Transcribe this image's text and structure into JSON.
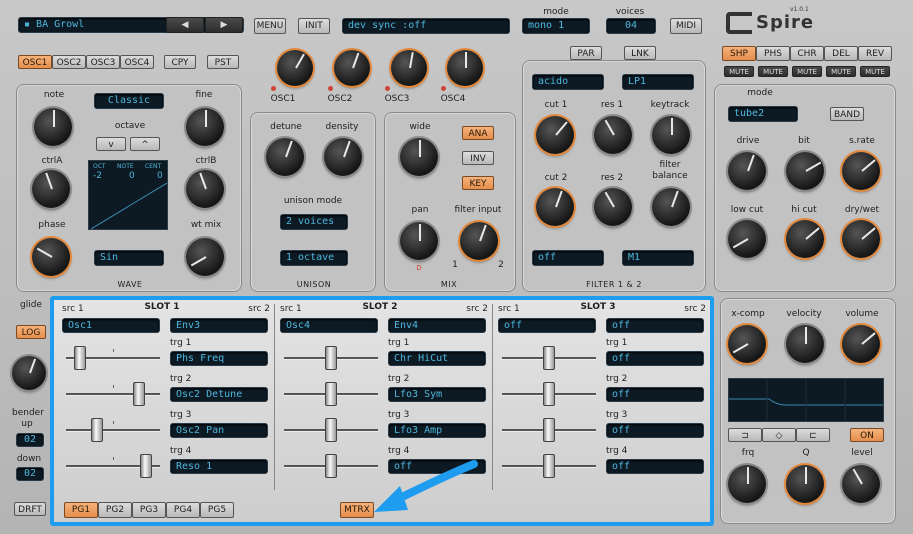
{
  "header": {
    "preset": "BA Growl",
    "menu": "MENU",
    "init": "INIT",
    "sync": "dev sync :off",
    "mode_label": "mode",
    "mode_value": "mono 1",
    "voices_label": "voices",
    "voices_value": "04",
    "midi": "MIDI",
    "logo": "Spire",
    "version": "v1.0.1"
  },
  "osc_tabs": [
    "OSC1",
    "OSC2",
    "OSC3",
    "OSC4"
  ],
  "copy": "CPY",
  "paste": "PST",
  "osc_knob_labels": [
    "OSC1",
    "OSC2",
    "OSC3",
    "OSC4"
  ],
  "par": "PAR",
  "lnk": "LNK",
  "fx_tabs": [
    "SHP",
    "PHS",
    "CHR",
    "DEL",
    "REV"
  ],
  "mute": "MUTE",
  "osc": {
    "note": "note",
    "fine": "fine",
    "mode": "Classic",
    "octave": "octave",
    "down": "v",
    "up": "^",
    "ctrlA": "ctrlA",
    "ctrlB": "ctrlB",
    "phase": "phase",
    "wtmix": "wt mix",
    "wave": "Sin",
    "section": "WAVE",
    "disp_oct": "OCT",
    "disp_note": "NOTE",
    "disp_cent": "CENT",
    "oct_val": "-2",
    "note_val": "0",
    "cent_val": "0"
  },
  "unison": {
    "detune": "detune",
    "density": "density",
    "mode_label": "unison mode",
    "voices": "2 voices",
    "octave": "1 octave",
    "section": "UNISON"
  },
  "mix": {
    "wide": "wide",
    "ana": "ANA",
    "inv": "INV",
    "key": "KEY",
    "pan": "pan",
    "filter_input": "filter input",
    "section": "MIX",
    "l": "D",
    "one": "1",
    "two": "2"
  },
  "filter": {
    "type1": "acido",
    "type2": "LP1",
    "cut1": "cut 1",
    "res1": "res 1",
    "keytrack": "keytrack",
    "cut2": "cut 2",
    "res2": "res 2",
    "balance": "filter balance",
    "mode1": "off",
    "mode2": "M1",
    "section": "FILTER 1 & 2"
  },
  "shape": {
    "mode_label": "mode",
    "mode": "tube2",
    "band": "BAND",
    "drive": "drive",
    "bit": "bit",
    "srate": "s.rate",
    "lowcut": "low cut",
    "hicut": "hi cut",
    "drywet": "dry/wet"
  },
  "side": {
    "glide": "glide",
    "log": "LOG",
    "bender_up": "bender up",
    "up_val": "02",
    "down": "down",
    "down_val": "02",
    "drft": "DRFT"
  },
  "eq": {
    "xcomp": "x-comp",
    "velocity": "velocity",
    "volume": "volume",
    "on": "ON",
    "frq": "frq",
    "q": "Q",
    "level": "level"
  },
  "matrix": {
    "slots": [
      {
        "title": "SLOT 1",
        "src1": "Osc1",
        "src2": "Env3",
        "trg": [
          "Phs Freq",
          "Osc2 Detune",
          "Osc2 Pan",
          "Reso 1"
        ]
      },
      {
        "title": "SLOT 2",
        "src1": "Osc4",
        "src2": "Env4",
        "trg": [
          "Chr HiCut",
          "Lfo3 Sym",
          "Lfo3 Amp",
          "off"
        ]
      },
      {
        "title": "SLOT 3",
        "src1": "off",
        "src2": "off",
        "trg": [
          "off",
          "off",
          "off",
          "off"
        ]
      }
    ],
    "src1_label": "src 1",
    "src2_label": "src 2",
    "trg_labels": [
      "trg 1",
      "trg 2",
      "trg 3",
      "trg 4"
    ],
    "slider_values": [
      [
        0.1,
        0.82,
        0.3,
        0.9
      ],
      [
        0.5,
        0.5,
        0.5,
        0.5
      ],
      [
        0.5,
        0.5,
        0.5,
        0.5
      ]
    ],
    "pages": [
      "PG1",
      "PG2",
      "PG3",
      "PG4",
      "PG5"
    ],
    "mtrx": "MTRX"
  },
  "colors": {
    "accent": "#1e9cf0",
    "orange": "#e48e4d",
    "lcd": "#4fb6dc"
  }
}
